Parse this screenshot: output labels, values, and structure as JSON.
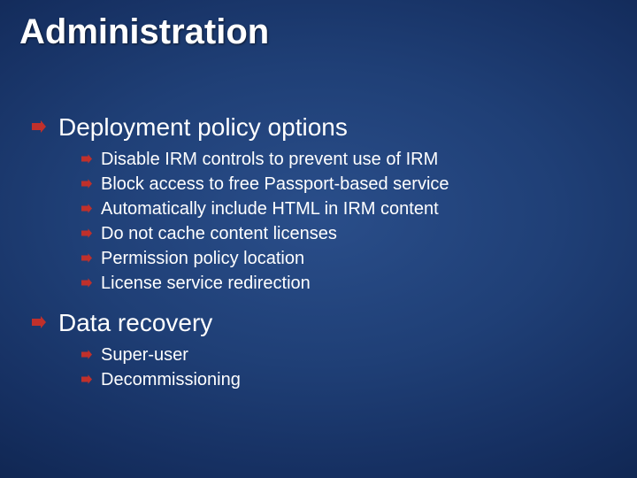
{
  "slide": {
    "title": "Administration",
    "sections": [
      {
        "heading": "Deployment policy options",
        "items": [
          "Disable IRM controls to prevent use of IRM",
          "Block access to free Passport-based service",
          "Automatically include HTML in IRM content",
          "Do not cache content licenses",
          "Permission policy location",
          "License service redirection"
        ]
      },
      {
        "heading": "Data recovery",
        "items": [
          "Super-user",
          "Decommissioning"
        ]
      }
    ]
  }
}
